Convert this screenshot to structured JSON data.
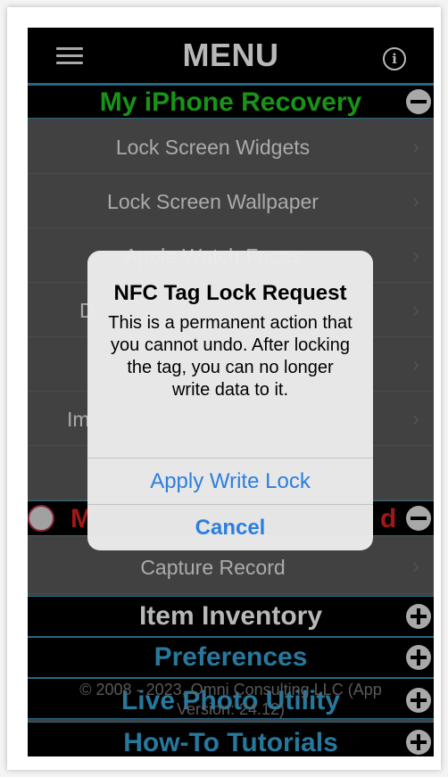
{
  "header": {
    "title": "MENU"
  },
  "sections": {
    "recovery": {
      "title": "My iPhone Recovery",
      "color": "#22cc22"
    },
    "partial_red": {
      "title_left": "M",
      "title_right": "d",
      "color": "#e02222"
    },
    "inventory": {
      "title": "Item Inventory",
      "color": "#ffffff"
    },
    "preferences": {
      "title": "Preferences",
      "color": "#35a8d8"
    },
    "live_photo": {
      "title": "Live Photo Utility",
      "color": "#35a8d8"
    },
    "tutorials": {
      "title": "How-To Tutorials",
      "color": "#35a8d8"
    }
  },
  "rows": [
    {
      "label": "Lock Screen Widgets"
    },
    {
      "label": "Lock Screen Wallpaper"
    },
    {
      "label": "Apple Watch Faces"
    },
    {
      "label": "D"
    },
    {
      "label": ""
    },
    {
      "label": "Im"
    },
    {
      "label": ""
    }
  ],
  "capture_row": {
    "label": "Capture Record"
  },
  "footer": {
    "copyright": "© 2008 - 2023, Omni Consulting LLC (App",
    "version": "Version: 24.12)"
  },
  "alert": {
    "title": "NFC Tag Lock Request",
    "message": "This is a permanent action that you cannot undo. After locking the tag, you can no longer write data to it.",
    "primary_button": "Apply Write Lock",
    "cancel_button": "Cancel"
  }
}
